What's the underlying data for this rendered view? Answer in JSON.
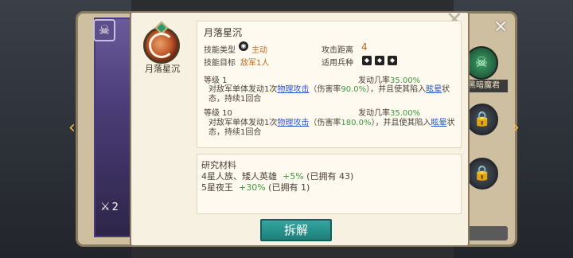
{
  "skill": {
    "name": "月落星沉",
    "icon_name": "月落星沉",
    "type_label": "技能类型",
    "type_value": "主动",
    "distance_label": "攻击距离",
    "distance_value": "4",
    "target_label": "技能目标",
    "target_value": "敌军1人",
    "troop_label": "适用兵种"
  },
  "levels": [
    {
      "level_label": "等级 1",
      "prob_label": "发动几率",
      "prob_value": "35.00%",
      "desc_pre": "对敌军单体发动1次",
      "desc_link": "物理攻击",
      "desc_mid": "（伤害率",
      "desc_rate": "90.0%",
      "desc_post": "），并且使其陷入",
      "desc_link2": "眩晕",
      "desc_end": "状态，持续1回合"
    },
    {
      "level_label": "等级 10",
      "prob_label": "发动几率",
      "prob_value": "35.00%",
      "desc_pre": "对敌军单体发动1次",
      "desc_link": "物理攻击",
      "desc_mid": "（伤害率",
      "desc_rate": "180.0%",
      "desc_post": "），并且使其陷入",
      "desc_link2": "眩晕",
      "desc_end": "状态，持续1回合"
    }
  ],
  "research": {
    "title": "研究材料",
    "items": [
      {
        "name": "4星人族、矮人英雄",
        "bonus": "+5%",
        "owned": "(已拥有 43)"
      },
      {
        "name": "5星夜王",
        "bonus": "+30%",
        "owned": "(已拥有 1)"
      }
    ]
  },
  "buttons": {
    "disassemble": "拆解"
  },
  "right_panel": {
    "badge_label": "黑暗魔君"
  },
  "hero": {
    "power": "2"
  },
  "colors": {
    "accent": "#1c7f7a",
    "green": "#3a9a3a",
    "link": "#2c57c8",
    "orange": "#c06a1e"
  }
}
